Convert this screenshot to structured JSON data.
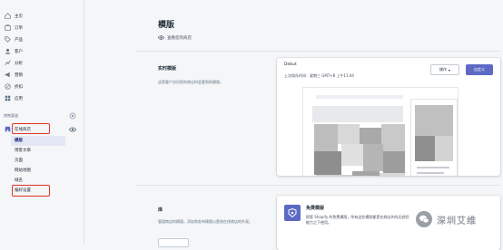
{
  "sidebar": {
    "items": [
      {
        "label": "主页",
        "icon": "home-icon"
      },
      {
        "label": "订单",
        "icon": "orders-icon"
      },
      {
        "label": "产品",
        "icon": "tag-icon"
      },
      {
        "label": "客户",
        "icon": "customers-icon"
      },
      {
        "label": "分析",
        "icon": "analytics-icon"
      },
      {
        "label": "营销",
        "icon": "marketing-icon"
      },
      {
        "label": "折扣",
        "icon": "discount-icon"
      },
      {
        "label": "应用",
        "icon": "apps-icon"
      }
    ],
    "sales_channels_label": "销售渠道",
    "online_store_label": "在线商店",
    "sub_items": [
      "模版",
      "博客文章",
      "页面",
      "网站地图",
      "域名",
      "偏好设置"
    ]
  },
  "main": {
    "title": "模版",
    "view_store": "查看您的商店",
    "live_theme": {
      "title": "实时模版",
      "desc": "这是客户访问您的商店时会看到的模版。",
      "theme_name": "Debut",
      "last_saved": "上次保存时间：星期三 GMT+8 上午11:44",
      "actions_label": "操作",
      "customize_label": "自定义"
    },
    "library": {
      "title": "库",
      "desc": "管理商店的模版。添加和发布模版以更改在线商店的外观。"
    },
    "free_themes": {
      "title": "免费模版",
      "desc": "探索 Shopify 的免费模版，所有这些模版都是在商店外的无经验能力之下使用。"
    }
  },
  "watermark": "深圳艾维",
  "colors": {
    "accent": "#5c6ac4",
    "highlight": "#e1332a"
  }
}
